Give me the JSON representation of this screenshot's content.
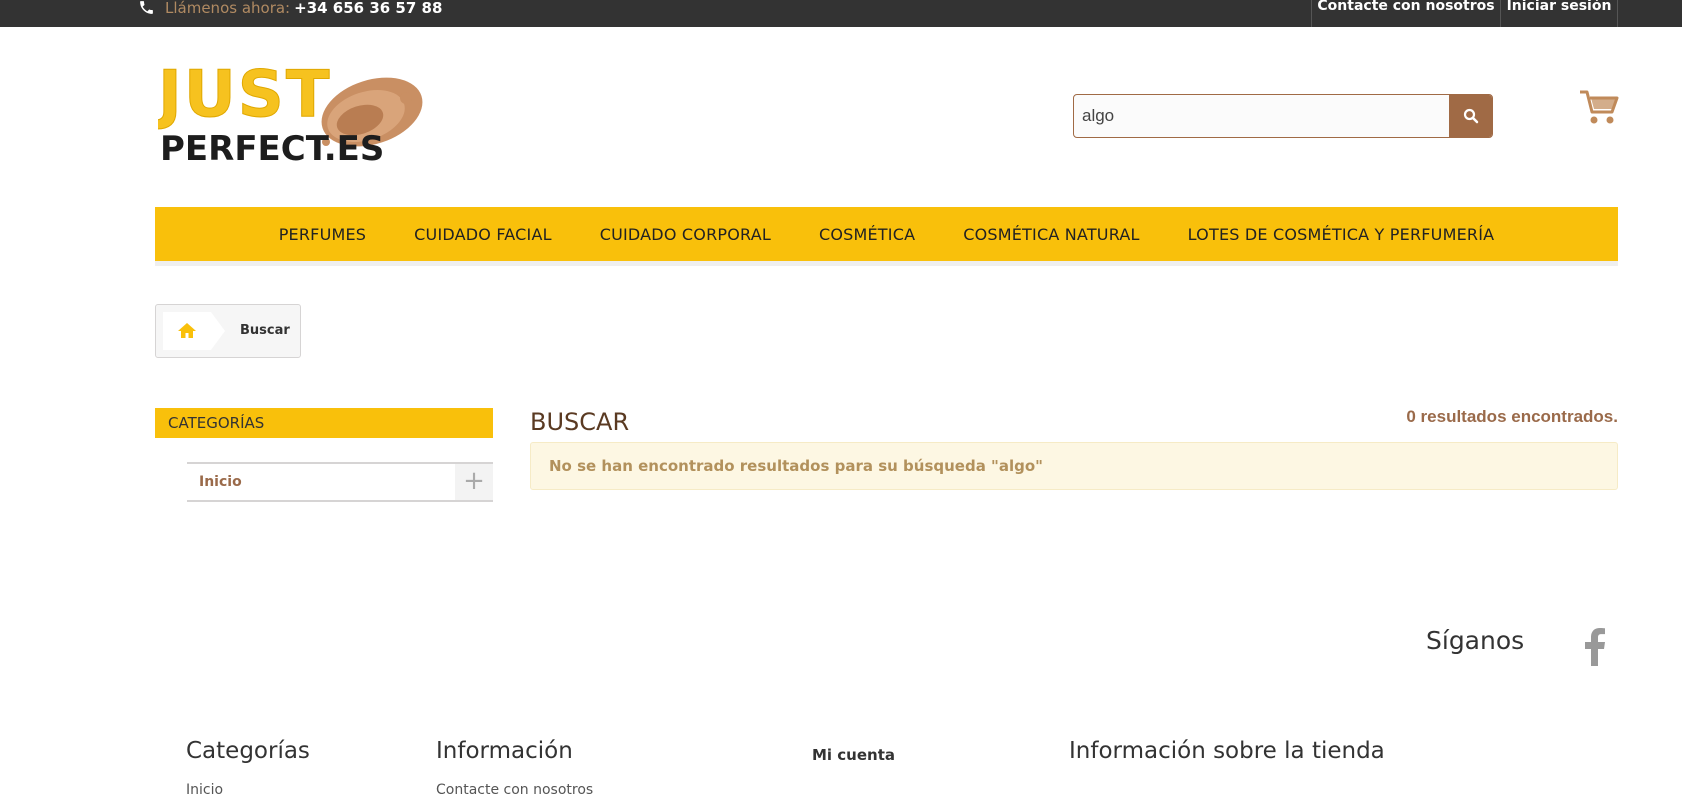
{
  "topbar": {
    "call_label": "Llámenos ahora:",
    "phone": "+34 656 36 57 88",
    "contact_link": "Contacte con nosotros",
    "login_link": "Iniciar sesión"
  },
  "header": {
    "logo_line1": "JUST",
    "logo_line2": "PERFECT.ES",
    "search": {
      "value": "algo"
    }
  },
  "nav": {
    "items": [
      "PERFUMES",
      "CUIDADO FACIAL",
      "CUIDADO CORPORAL",
      "COSMÉTICA",
      "COSMÉTICA NATURAL",
      "LOTES DE COSMÉTICA Y PERFUMERÍA"
    ]
  },
  "breadcrumb": {
    "current": "Buscar"
  },
  "sidebar": {
    "title": "CATEGORÍAS",
    "items": [
      {
        "label": "Inicio"
      }
    ]
  },
  "main": {
    "heading": "BUSCAR",
    "results_count": "0 resultados encontrados.",
    "alert": "No se han encontrado resultados para su búsqueda \"algo\""
  },
  "footer": {
    "follow_title": "Síganos",
    "columns": {
      "categories": "Categorías",
      "information": "Información",
      "account": "Mi cuenta",
      "store_info": "Información sobre la tienda"
    },
    "sub": {
      "categories_first": "Inicio",
      "information_first": "Contacte con nosotros"
    }
  },
  "colors": {
    "accent_yellow": "#f9c00b",
    "brand_brown": "#a06a45",
    "topbar": "#333333"
  }
}
